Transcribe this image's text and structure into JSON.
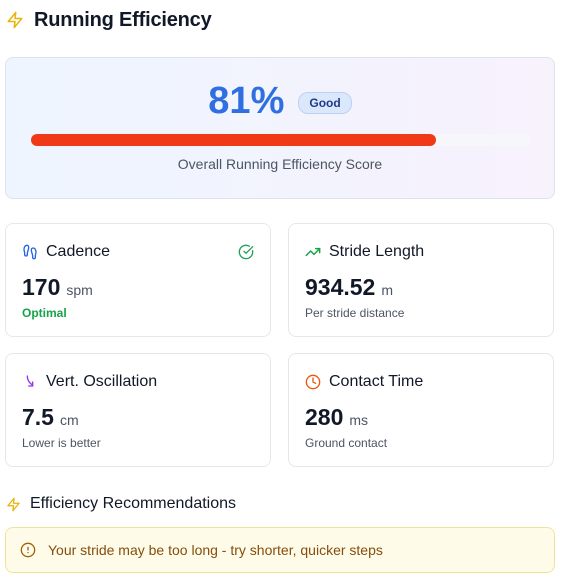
{
  "header": {
    "title": "Running Efficiency",
    "icon": "lightning-icon"
  },
  "score": {
    "value_text": "81%",
    "value": 81,
    "badge": "Good",
    "label": "Overall Running Efficiency Score",
    "bar_fill_fraction": 0.81,
    "colors": {
      "value": "#2f6fe0",
      "bar": "#f03a17"
    }
  },
  "metrics": [
    {
      "title": "Cadence",
      "icon": "footprints-icon",
      "value": "170",
      "unit": "spm",
      "sub": "Optimal",
      "status_icon": "check-circle-icon"
    },
    {
      "title": "Stride Length",
      "icon": "trending-up-icon",
      "value": "934.52",
      "unit": "m",
      "sub": "Per stride distance"
    },
    {
      "title": "Vert. Oscillation",
      "icon": "arrow-down-curve-icon",
      "value": "7.5",
      "unit": "cm",
      "sub": "Lower is better"
    },
    {
      "title": "Contact Time",
      "icon": "clock-icon",
      "value": "280",
      "unit": "ms",
      "sub": "Ground contact"
    }
  ],
  "recommendations": {
    "title": "Efficiency Recommendations",
    "items": [
      "Your stride may be too long - try shorter, quicker steps"
    ]
  }
}
